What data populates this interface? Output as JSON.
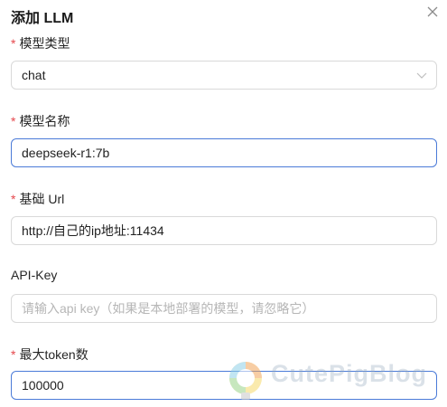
{
  "dialog": {
    "title": "添加 LLM"
  },
  "fields": {
    "model_type": {
      "label": "模型类型",
      "required": "*",
      "value": "chat"
    },
    "model_name": {
      "label": "模型名称",
      "required": "*",
      "value": "deepseek-r1:7b"
    },
    "base_url": {
      "label": "基础 Url",
      "required": "*",
      "value": "http://自己的ip地址:11434"
    },
    "api_key": {
      "label": "API-Key",
      "placeholder": "请输入api key（如果是本地部署的模型，请忽略它）"
    },
    "max_tokens": {
      "label": "最大token数",
      "required": "*",
      "value": "100000"
    }
  },
  "watermark": {
    "text": "CutePigBlog"
  },
  "colors": {
    "required": "#e5484d",
    "focus_border": "#4b7bd8",
    "border": "#d9d9d9"
  },
  "icons": {
    "close": "close-icon",
    "select_arrow": "chevron-down-icon",
    "watermark_logo": "bulb-logo-icon"
  }
}
